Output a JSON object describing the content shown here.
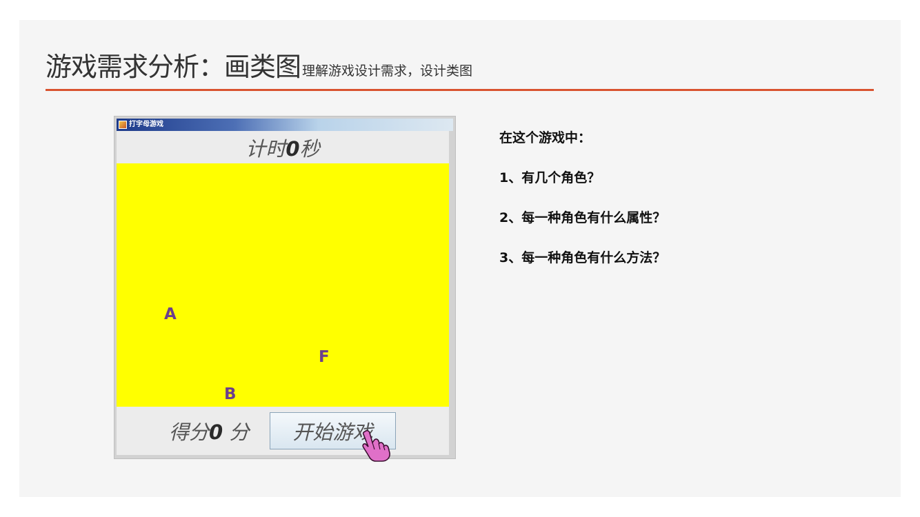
{
  "slide": {
    "title_main": "游戏需求分析：画类图",
    "title_sub": "理解游戏设计需求，设计类图",
    "accent_color": "#d9532f"
  },
  "game_window": {
    "window_title": "打字母游戏",
    "timer": {
      "prefix": "计时",
      "value": "0",
      "suffix": "秒"
    },
    "play_area_color": "#ffff00",
    "letters": [
      "A",
      "F",
      "B"
    ],
    "score": {
      "prefix": "得分",
      "value": "0",
      "suffix": " 分"
    },
    "start_button_label": "开始游戏",
    "icons": {
      "cursor": "hand-pointer-icon",
      "window": "java-app-icon"
    }
  },
  "questions": [
    "在这个游戏中：",
    "1、有几个角色？",
    "2、每一种角色有什么属性？",
    "3、每一种角色有什么方法？"
  ]
}
